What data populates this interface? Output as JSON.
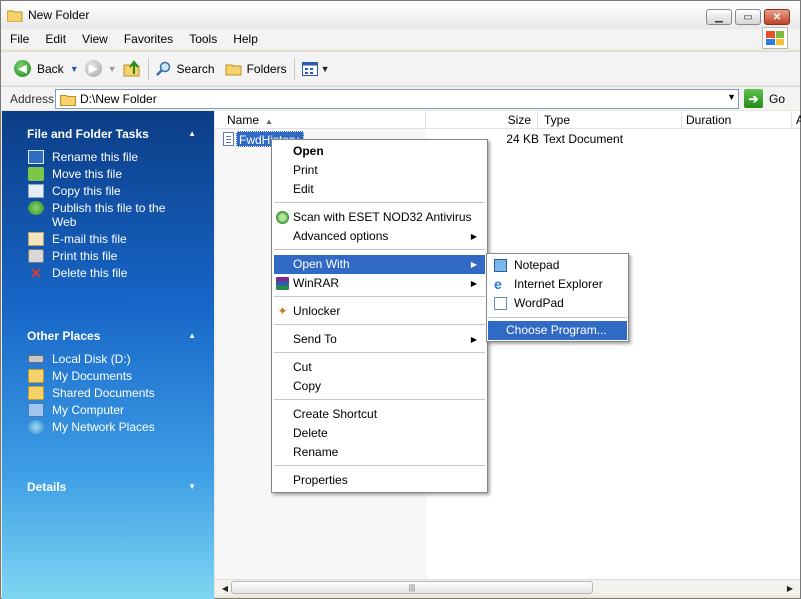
{
  "window": {
    "title": "New Folder"
  },
  "menubar": {
    "items": [
      "File",
      "Edit",
      "View",
      "Favorites",
      "Tools",
      "Help"
    ]
  },
  "toolbar": {
    "back": "Back",
    "search": "Search",
    "folders": "Folders"
  },
  "address": {
    "label": "Address",
    "value": "D:\\New Folder",
    "go": "Go"
  },
  "tasks": {
    "file_folder": {
      "title": "File and Folder Tasks",
      "items": [
        "Rename this file",
        "Move this file",
        "Copy this file",
        "Publish this file to the Web",
        "E-mail this file",
        "Print this file",
        "Delete this file"
      ]
    },
    "other_places": {
      "title": "Other Places",
      "items": [
        "Local Disk (D:)",
        "My Documents",
        "Shared Documents",
        "My Computer",
        "My Network Places"
      ]
    },
    "details": {
      "title": "Details"
    }
  },
  "columns": {
    "name": "Name",
    "size": "Size",
    "type": "Type",
    "duration": "Duration",
    "extra": "A"
  },
  "file": {
    "name": "FwdHistory",
    "size": "24 KB",
    "type": "Text Document"
  },
  "context_menu": {
    "open": "Open",
    "print": "Print",
    "edit": "Edit",
    "scan": "Scan with ESET NOD32 Antivirus",
    "advanced": "Advanced options",
    "open_with": "Open With",
    "winrar": "WinRAR",
    "unlocker": "Unlocker",
    "send_to": "Send To",
    "cut": "Cut",
    "copy": "Copy",
    "create_shortcut": "Create Shortcut",
    "delete": "Delete",
    "rename": "Rename",
    "properties": "Properties"
  },
  "open_with_menu": {
    "notepad": "Notepad",
    "ie": "Internet Explorer",
    "wordpad": "WordPad",
    "choose": "Choose Program..."
  },
  "colors": {
    "selection": "#316ac5",
    "taskpane_top": "#0c3d86",
    "taskpane_bottom": "#7fd6f2"
  }
}
